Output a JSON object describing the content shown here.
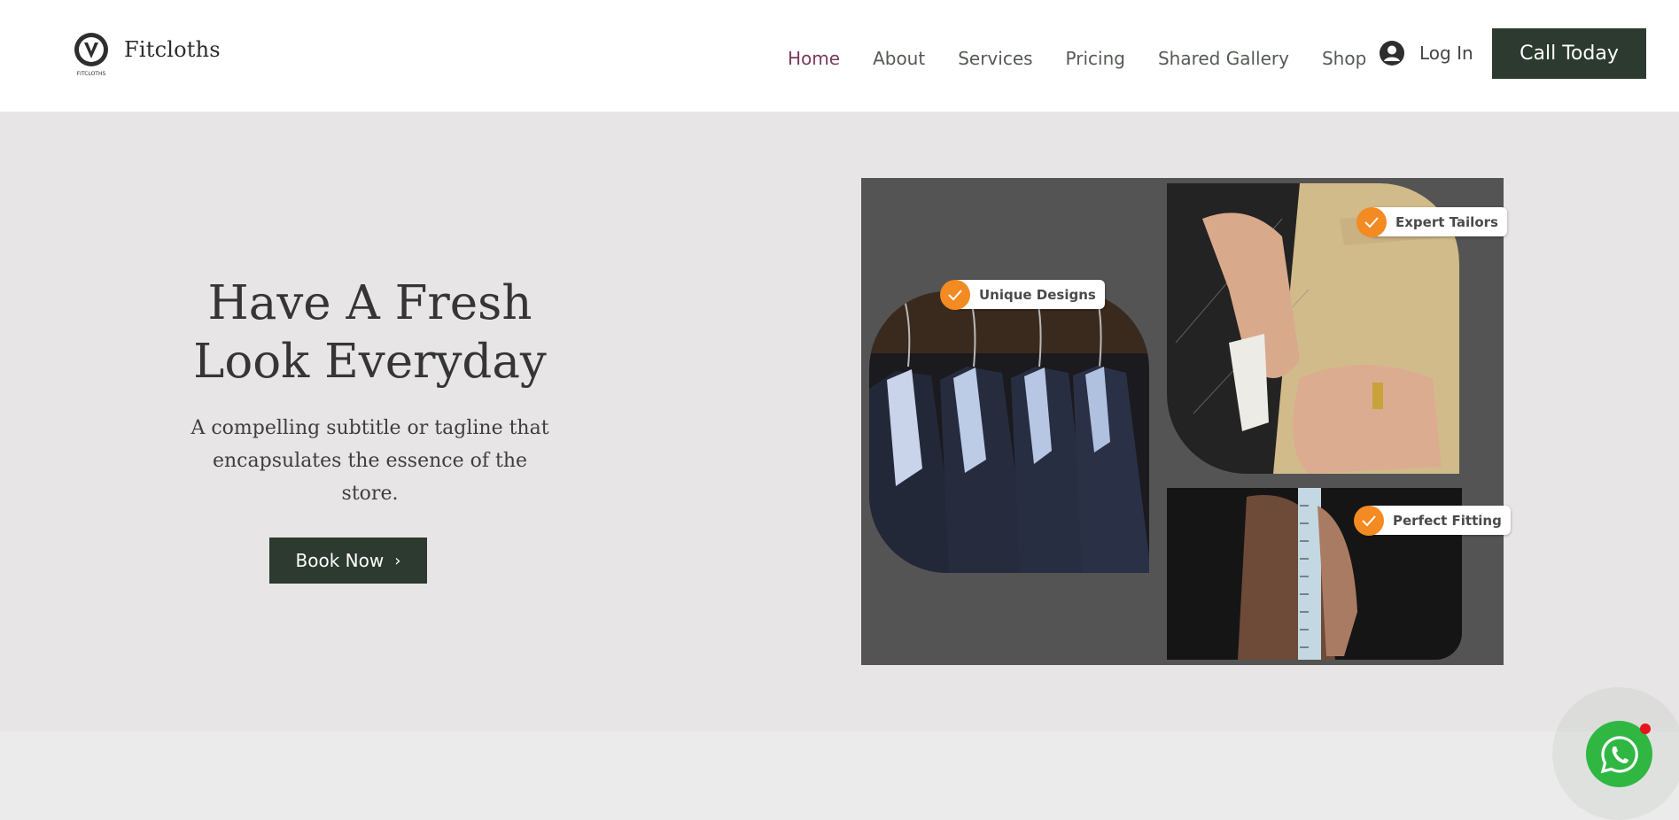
{
  "header": {
    "brand": "Fitcloths",
    "logo_text": "FITCLOTHS",
    "nav": [
      {
        "label": "Home",
        "active": true
      },
      {
        "label": "About",
        "active": false
      },
      {
        "label": "Services",
        "active": false
      },
      {
        "label": "Pricing",
        "active": false
      },
      {
        "label": "Shared Gallery",
        "active": false
      },
      {
        "label": "Shop",
        "active": false
      }
    ],
    "login_label": "Log In",
    "cta_label": "Call Today"
  },
  "hero": {
    "headline": "Have A Fresh Look Everyday",
    "tagline": "A compelling subtitle or tagline that encapsulates the essence of the store.",
    "book_label": "Book Now"
  },
  "gallery": {
    "badges": [
      "Unique Designs",
      "Expert Tailors",
      "Perfect Fitting"
    ]
  },
  "colors": {
    "accent_dark_green": "#2c3a2f",
    "active_nav": "#7a3b5c",
    "badge_orange": "#f38a22",
    "whatsapp_green": "#2fb742"
  },
  "icons": {
    "user": "user-circle-icon",
    "whatsapp": "whatsapp-icon",
    "check": "check-icon",
    "chevron": "chevron-right-icon"
  }
}
